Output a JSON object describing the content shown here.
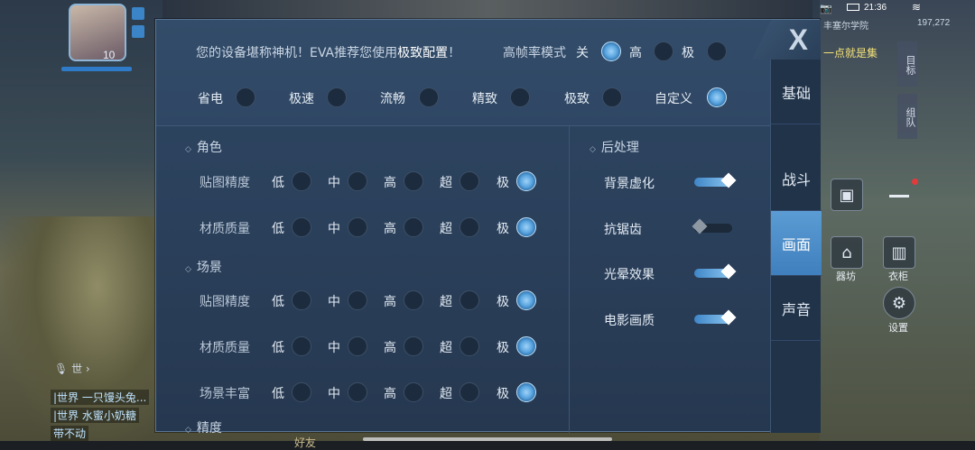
{
  "hud": {
    "level": "10",
    "chat": [
      {
        "channel": "|世界",
        "text": "一只馒头兔..."
      },
      {
        "channel": "|世界",
        "text": "水蜜小奶糖"
      }
    ],
    "chat_footer": "带不动",
    "voice_label": "世",
    "bottom_label": "好友",
    "status_time": "21:36",
    "server_name": "丰塞尔学院",
    "server_coord": "197,272",
    "quest_text": "一点就是集",
    "quest_side": [
      "目标",
      "组队"
    ],
    "right_labels": [
      "器坊",
      "衣柜",
      "设置"
    ]
  },
  "settings": {
    "header": {
      "prefix": "您的设备堪称神机！EVA推荐您使用",
      "highlight": "极致配置",
      "suffix": "！"
    },
    "high_fps": {
      "label": "高帧率模式",
      "options": [
        "关",
        "高",
        "极"
      ],
      "selected": "关"
    },
    "presets": {
      "options": [
        "省电",
        "极速",
        "流畅",
        "精致",
        "极致",
        "自定义"
      ],
      "selected": "自定义"
    },
    "tabs": [
      "基础",
      "战斗",
      "画面",
      "声音"
    ],
    "active_tab": "画面",
    "close_label": "X",
    "level_options": [
      "低",
      "中",
      "高",
      "超",
      "极"
    ],
    "sections": [
      {
        "title": "角色",
        "rows": [
          {
            "label": "贴图精度",
            "selected": "极"
          },
          {
            "label": "材质质量",
            "selected": "极"
          }
        ]
      },
      {
        "title": "场景",
        "rows": [
          {
            "label": "贴图精度",
            "selected": "极"
          },
          {
            "label": "材质质量",
            "selected": "极"
          },
          {
            "label": "场景丰富",
            "selected": "极"
          }
        ]
      },
      {
        "title": "精度",
        "rows": []
      }
    ],
    "post_processing": {
      "title": "后处理",
      "toggles": [
        {
          "label": "背景虚化",
          "on": true
        },
        {
          "label": "抗锯齿",
          "on": false
        },
        {
          "label": "光晕效果",
          "on": true
        },
        {
          "label": "电影画质",
          "on": true
        }
      ]
    }
  }
}
